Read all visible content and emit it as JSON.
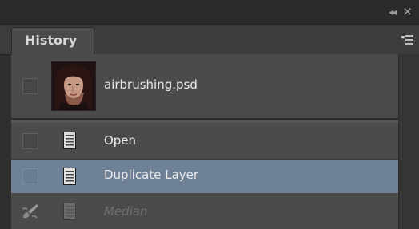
{
  "panel": {
    "tab_label": "History",
    "collapse_glyph": "◂◂",
    "close_glyph": "×"
  },
  "snapshot": {
    "name": "airbrushing.psd",
    "icon": "portrait-thumbnail"
  },
  "history_states": [
    {
      "label": "Open",
      "icon": "document-icon",
      "selected": false,
      "dimmed": false
    },
    {
      "label": "Duplicate Layer",
      "icon": "document-icon",
      "selected": true,
      "dimmed": false
    },
    {
      "label": "Median",
      "icon": "document-icon",
      "selected": false,
      "dimmed": true
    }
  ],
  "colors": {
    "selection": "#6e8197",
    "panel_bg": "#4b4b4b"
  }
}
